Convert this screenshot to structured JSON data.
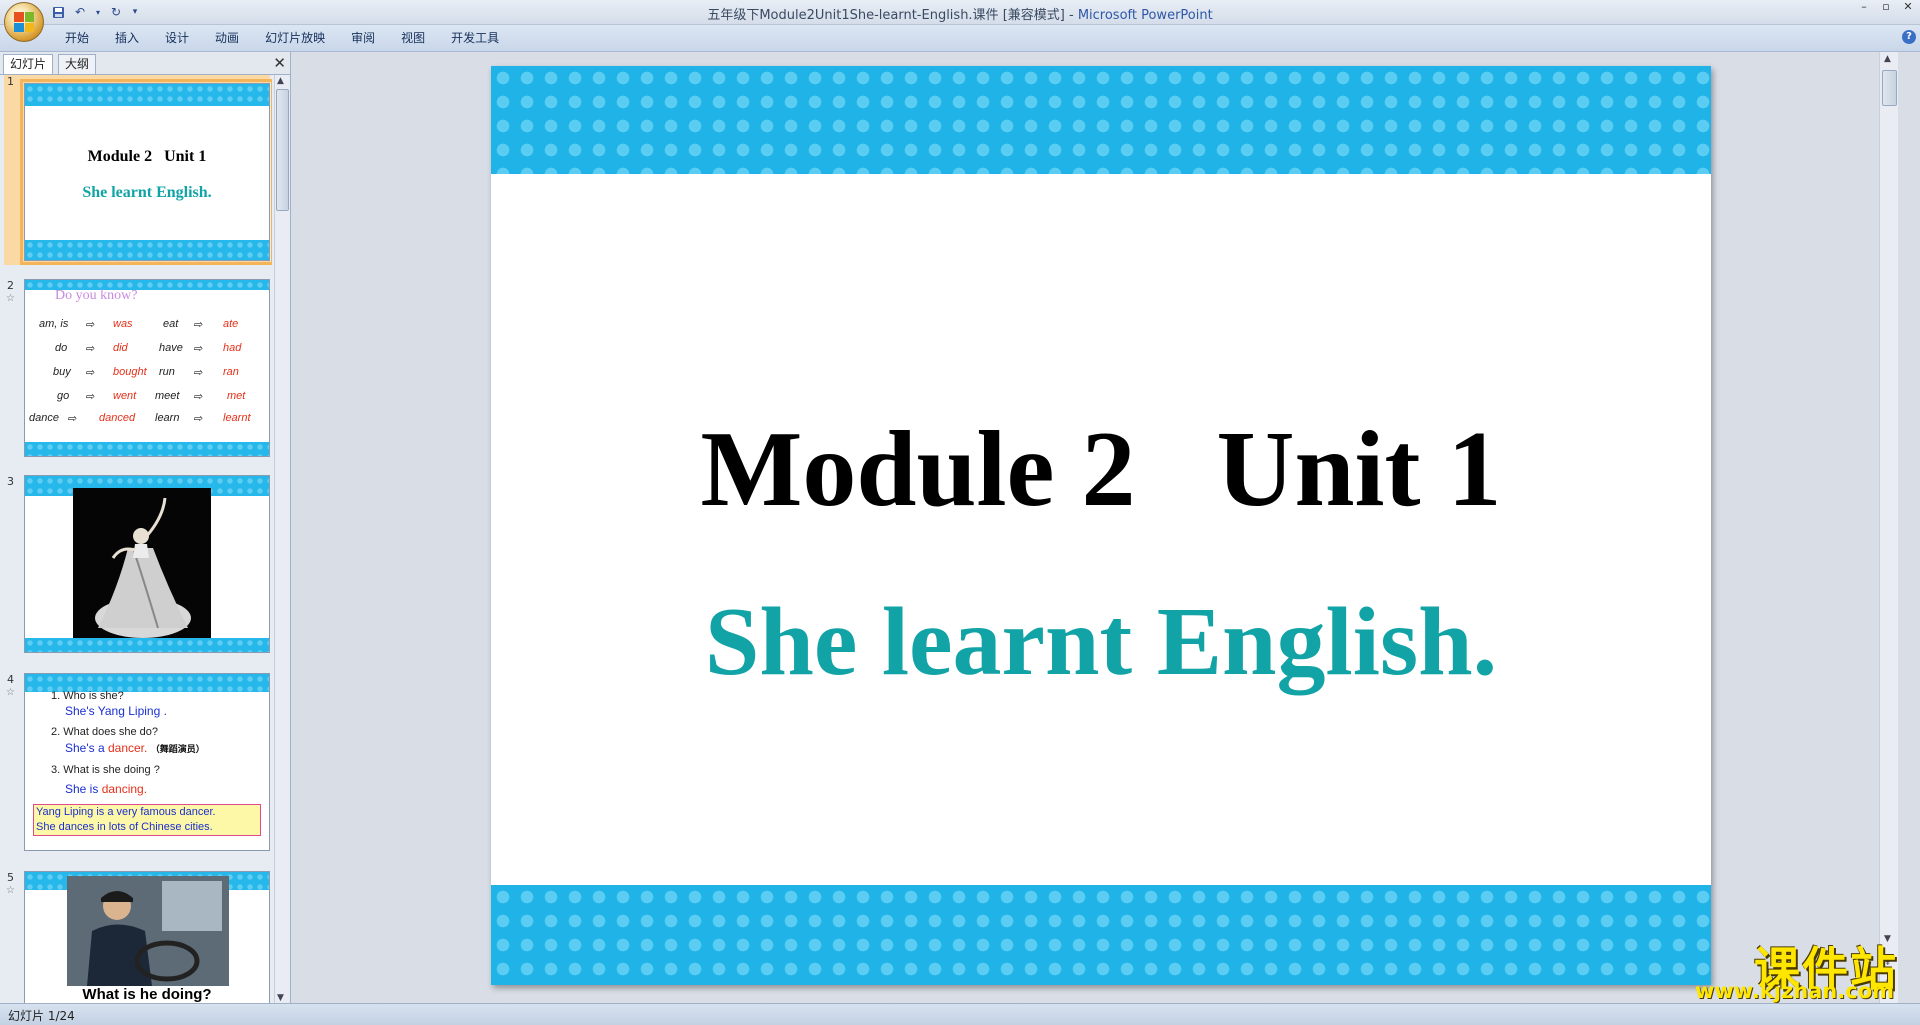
{
  "window": {
    "title_doc": "五年级下Module2Unit1She-learnt-English.课件 [兼容模式]",
    "title_sep": " - ",
    "title_app": "Microsoft PowerPoint"
  },
  "ribbon": {
    "tabs": [
      "开始",
      "插入",
      "设计",
      "动画",
      "幻灯片放映",
      "审阅",
      "视图",
      "开发工具"
    ]
  },
  "leftpane": {
    "tab_slides": "幻灯片",
    "tab_outline": "大纲",
    "thumbnails": [
      {
        "num": "1",
        "title": "Module 2   Unit 1",
        "subtitle": "She learnt English."
      },
      {
        "num": "2",
        "title": "Do you know?",
        "pairs": [
          [
            "am, is",
            "was",
            "eat",
            "ate"
          ],
          [
            "do",
            "did",
            "have",
            "had"
          ],
          [
            "buy",
            "bought",
            "run",
            "ran"
          ],
          [
            "go",
            "went",
            "meet",
            "met"
          ],
          [
            "dance",
            "danced",
            "learn",
            "learnt"
          ]
        ]
      },
      {
        "num": "3"
      },
      {
        "num": "4",
        "q1": "1. Who is she?",
        "a1": "She's Yang Liping .",
        "q2": "2. What does she  do?",
        "a2_pre": "She's a ",
        "a2_word": "dancer.",
        "a2_note": "（舞蹈演员）",
        "q3": "3. What is she doing ?",
        "a3_pre": "She is ",
        "a3_word": "dancing.",
        "box1": "Yang Liping is a  very  famous dancer.",
        "box2": "She dances in lots of Chinese cities."
      },
      {
        "num": "5",
        "caption": "What is he doing?"
      }
    ]
  },
  "slide": {
    "title": "Module 2   Unit 1",
    "subtitle": "She learnt English."
  },
  "watermark": {
    "cn": "课件站",
    "url": "www.kjzhan.com"
  },
  "status": {
    "text": "幻灯片 1/24"
  },
  "colors": {
    "band": "#1fb3e8",
    "subtitle": "#12a3a6",
    "accent": "#f4b55a"
  }
}
